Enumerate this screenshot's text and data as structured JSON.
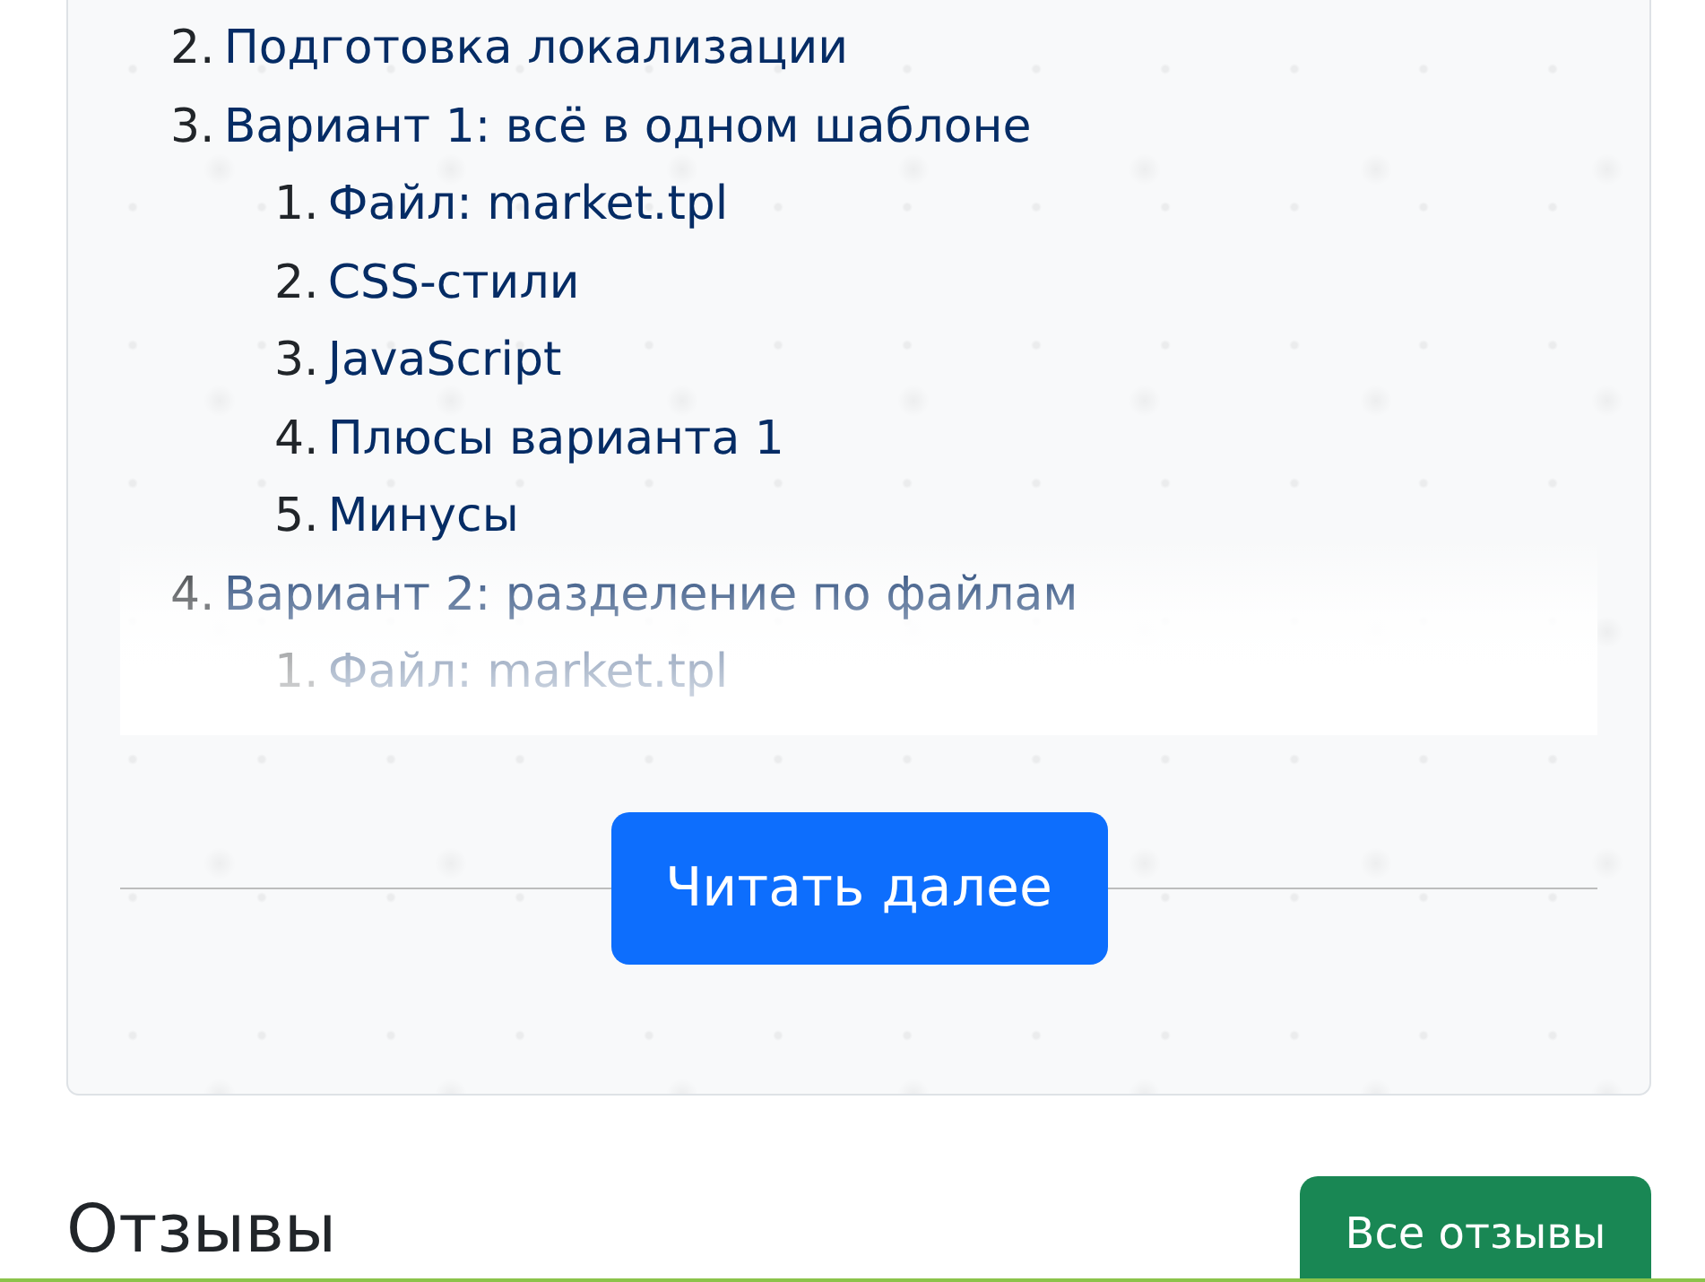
{
  "article": {
    "toc": [
      {
        "number": "2.",
        "label": "Подготовка локализации"
      },
      {
        "number": "3.",
        "label": "Вариант 1: всё в одном шаблоне",
        "children": [
          {
            "number": "1.",
            "label": "Файл: market.tpl"
          },
          {
            "number": "2.",
            "label": "CSS-стили"
          },
          {
            "number": "3.",
            "label": "JavaScript"
          },
          {
            "number": "4.",
            "label": "Плюсы варианта 1"
          },
          {
            "number": "5.",
            "label": "Минусы"
          }
        ]
      },
      {
        "number": "4.",
        "label": "Вариант 2: разделение по файлам",
        "children": [
          {
            "number": "1.",
            "label": "Файл: market.tpl"
          }
        ]
      }
    ],
    "read_more_button": "Читать далее"
  },
  "reviews": {
    "title": "Отзывы",
    "all_reviews_button": "Все отзывы"
  }
}
